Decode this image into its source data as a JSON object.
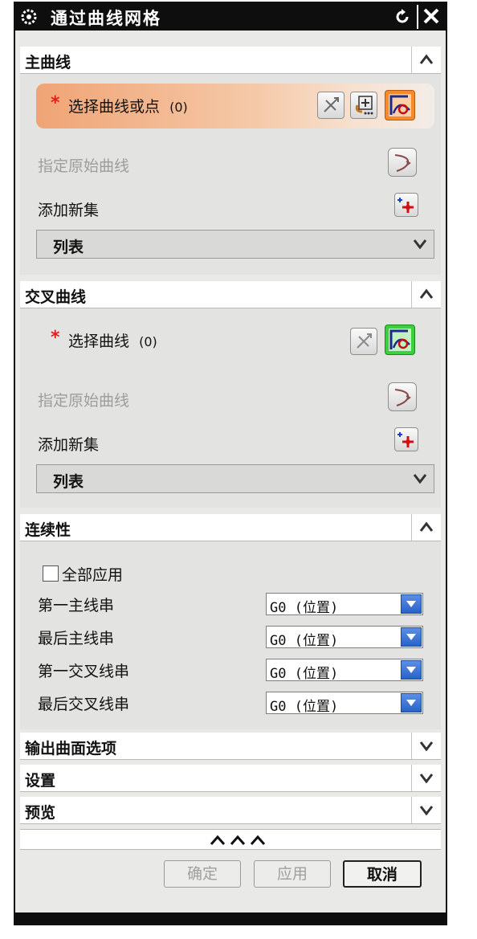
{
  "window": {
    "title": "通过曲线网格"
  },
  "main_curves": {
    "header": "主曲线",
    "select_label": "选择曲线或点",
    "select_count": "(0)",
    "specify_original": "指定原始曲线",
    "add_new_set": "添加新集",
    "list_label": "列表"
  },
  "cross_curves": {
    "header": "交叉曲线",
    "select_label": "选择曲线",
    "select_count": "(0)",
    "specify_original": "指定原始曲线",
    "add_new_set": "添加新集",
    "list_label": "列表"
  },
  "continuity": {
    "header": "连续性",
    "apply_all": "全部应用",
    "rows": [
      {
        "label": "第一主线串",
        "value": "G0 (位置)"
      },
      {
        "label": "最后主线串",
        "value": "G0 (位置)"
      },
      {
        "label": "第一交叉线串",
        "value": "G0 (位置)"
      },
      {
        "label": "最后交叉线串",
        "value": "G0 (位置)"
      }
    ]
  },
  "collapsed_sections": [
    "输出曲面选项",
    "设置",
    "预览"
  ],
  "buttons": {
    "ok": "确定",
    "apply": "应用",
    "cancel": "取消"
  },
  "colors": {
    "highlight": "#f0a475",
    "accent_orange": "#f58a2a",
    "accent_green": "#3ecf3e",
    "dropdown_blue": "#2a62c9"
  }
}
